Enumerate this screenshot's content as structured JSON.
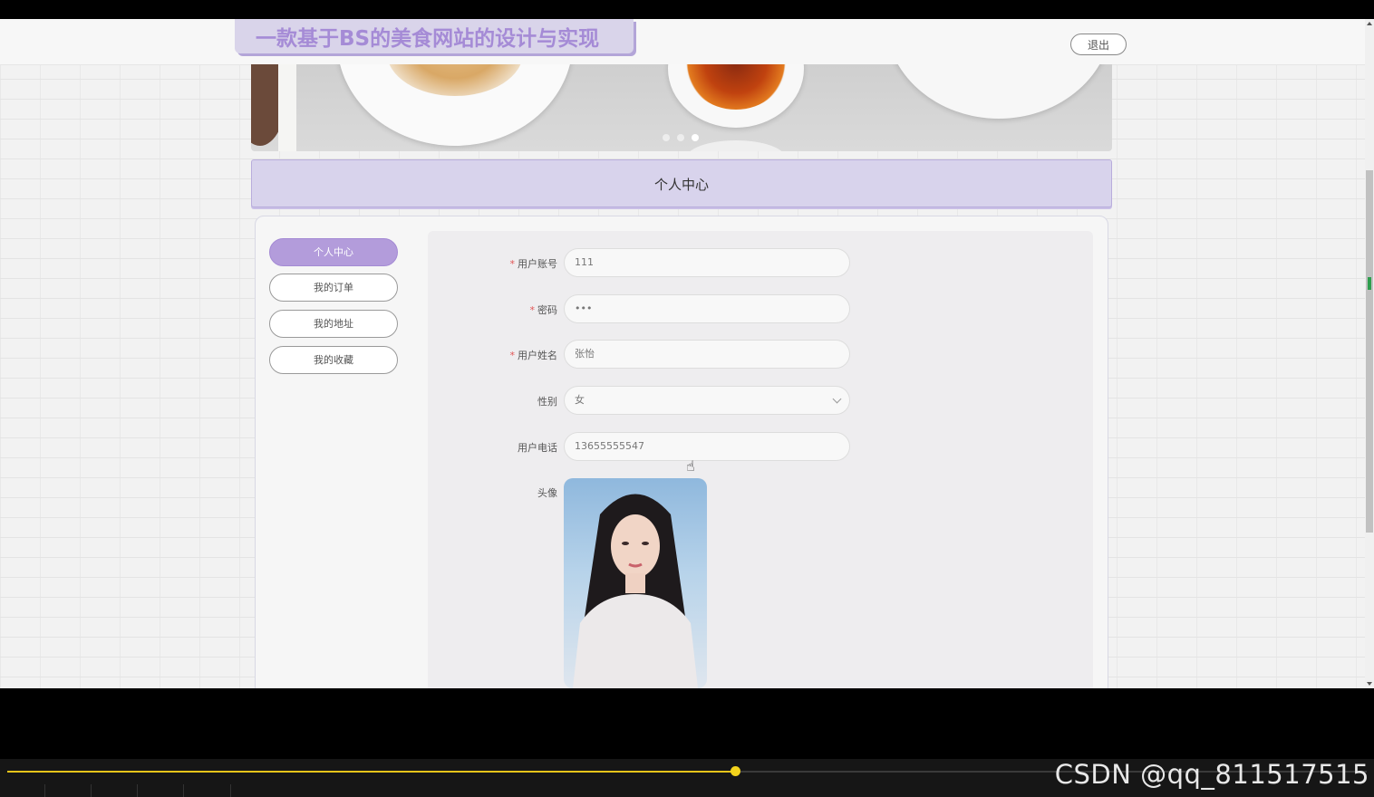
{
  "header": {
    "site_title": "一款基于BS的美食网站的设计与实现",
    "logout_label": "退出"
  },
  "banner": {
    "slide_count": 3,
    "active_slide": 3
  },
  "section": {
    "title": "个人中心"
  },
  "sidebar": {
    "items": [
      {
        "label": "个人中心",
        "active": true
      },
      {
        "label": "我的订单",
        "active": false
      },
      {
        "label": "我的地址",
        "active": false
      },
      {
        "label": "我的收藏",
        "active": false
      }
    ]
  },
  "form": {
    "account": {
      "label": "用户账号",
      "value": "111",
      "required": true
    },
    "password": {
      "label": "密码",
      "value": "•••",
      "required": true
    },
    "name": {
      "label": "用户姓名",
      "value": "张怡",
      "required": true
    },
    "gender": {
      "label": "性别",
      "value": "女"
    },
    "phone": {
      "label": "用户电话",
      "value": "13655555547"
    },
    "avatar": {
      "label": "头像"
    }
  },
  "player": {
    "progress": 0.535
  },
  "watermark": "CSDN @qq_811517515",
  "colors": {
    "accent": "#b39cdb",
    "title": "#a58bd6",
    "required": "#e25555",
    "progress": "#e6c41a"
  }
}
